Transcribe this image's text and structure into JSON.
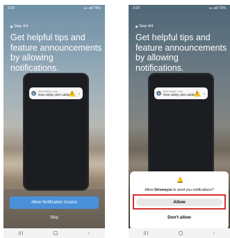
{
  "left_screen": {
    "status": {
      "time": "3:29",
      "right": "◂ ◃ ail 76%"
    },
    "step": "Step 4/4",
    "heading": "Get helpful tips and feature announcements by allowing notifications.",
    "notification": {
      "title": "New Feature • now",
      "body": "New safety alert added"
    },
    "allow_access_label": "Allow Notification Access",
    "skip_label": "Skip"
  },
  "right_screen": {
    "status": {
      "time": "3:29",
      "right": "◂ ◃ ail 72%"
    },
    "step": "Step 4/4",
    "heading": "Get helpful tips and feature announcements by allowing notifications.",
    "notification": {
      "title": "New Feature • now",
      "body": "New safety alert added"
    },
    "dialog": {
      "text_prefix": "Allow ",
      "app_name": "Drivewyze",
      "text_suffix": " to send you notifications?",
      "allow_label": "Allow",
      "dont_allow_label": "Don't allow"
    }
  },
  "colors": {
    "accent_blue": "#4a90d9",
    "highlight_red": "#d32f2f",
    "warning_yellow": "#f2c31a"
  },
  "icons": {
    "status": "battery-signal-icons",
    "bell": "bell-icon",
    "warning": "warning-triangle-icon"
  }
}
